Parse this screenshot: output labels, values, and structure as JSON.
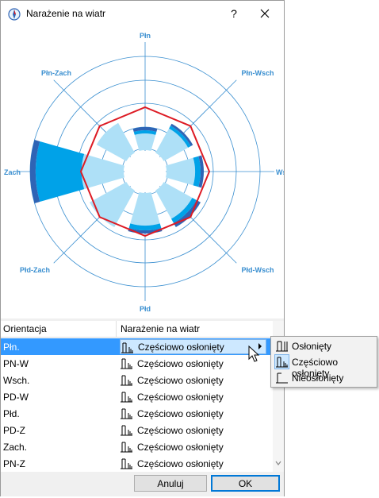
{
  "window": {
    "title": "Narażenie na wiatr",
    "help_label": "?"
  },
  "chart_data": {
    "type": "polar-bar",
    "directions": [
      "Płn",
      "Płn-Wsch",
      "Wsch",
      "Płd-Wsch",
      "Płd",
      "Płd-Zach",
      "Zach",
      "Płn-Zach"
    ],
    "rings": 5,
    "colors": {
      "light": "#aee0f7",
      "mid": "#00a2e8",
      "dark": "#2f64b5",
      "grid": "#3a8fd0",
      "outline": "#dd1b24"
    }
  },
  "table": {
    "headers": {
      "orientation": "Orientacja",
      "exposure": "Narażenie na wiatr"
    },
    "rows": [
      {
        "orientation": "Płn.",
        "exposure": "Częściowo osłonięty"
      },
      {
        "orientation": "PN-W",
        "exposure": "Częściowo osłonięty"
      },
      {
        "orientation": "Wsch.",
        "exposure": "Częściowo osłonięty"
      },
      {
        "orientation": "PD-W",
        "exposure": "Częściowo osłonięty"
      },
      {
        "orientation": "Płd.",
        "exposure": "Częściowo osłonięty"
      },
      {
        "orientation": "PD-Z",
        "exposure": "Częściowo osłonięty"
      },
      {
        "orientation": "Zach.",
        "exposure": "Częściowo osłonięty"
      },
      {
        "orientation": "PN-Z",
        "exposure": "Częściowo osłonięty"
      }
    ]
  },
  "dropdown": {
    "items": [
      {
        "label": "Osłonięty",
        "icon": "sheltered-icon"
      },
      {
        "label": "Częściowo osłonięty",
        "icon": "partially-sheltered-icon"
      },
      {
        "label": "Nieosłonięty",
        "icon": "exposed-icon"
      }
    ]
  },
  "buttons": {
    "cancel": "Anuluj",
    "ok": "OK"
  }
}
